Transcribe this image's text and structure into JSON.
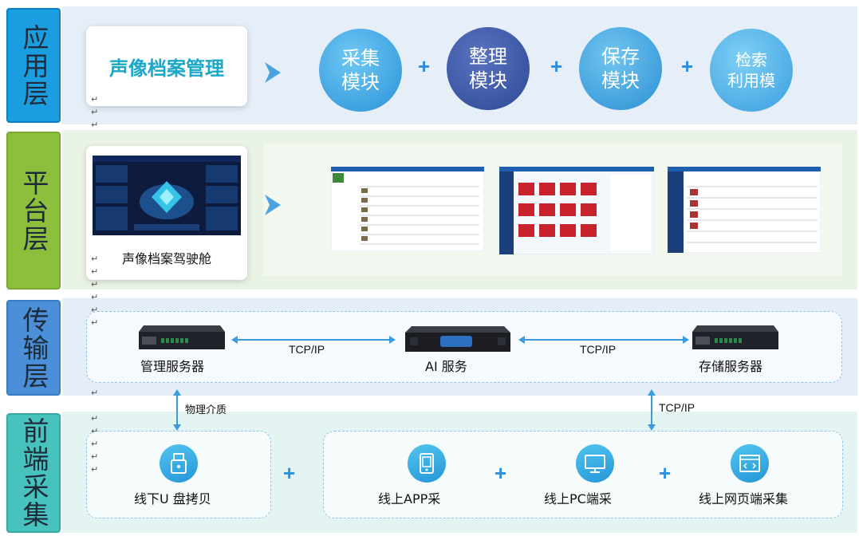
{
  "layers": [
    {
      "name": "应用层"
    },
    {
      "name": "平台层"
    },
    {
      "name": "传输层"
    },
    {
      "name": "前端采集"
    }
  ],
  "application": {
    "system_title": "声像档案管理",
    "modules": [
      {
        "label": "采集\n模块"
      },
      {
        "label": "整理\n模块"
      },
      {
        "label": "保存\n模块"
      },
      {
        "label": "检索\n利用模"
      }
    ],
    "plus": "+"
  },
  "platform": {
    "cockpit_label": "声像档案驾驶舱"
  },
  "transmission": {
    "servers": [
      {
        "label": "管理服务器"
      },
      {
        "label": "AI 服务"
      },
      {
        "label": "存储服务器"
      }
    ],
    "link_left": "TCP/IP",
    "link_right": "TCP/IP",
    "down_left": "物理介质",
    "down_right": "TCP/IP"
  },
  "frontend": {
    "offline": "线下U 盘拷贝",
    "online_app": "线上APP采",
    "online_pc": "线上PC端采",
    "online_web": "线上网页端采集",
    "plus": "+"
  },
  "colors": {
    "app_bg": "#e6eef8",
    "platform_bg": "#eaf4e6",
    "transmission_bg": "#e4edf8",
    "frontend_bg": "#e4f4f3",
    "app_tab": "#1b9ee0",
    "platform_tab": "#8ebf3c",
    "transmission_tab": "#4a8fd8",
    "frontend_tab": "#47c2bd",
    "accent": "#2596d8"
  }
}
